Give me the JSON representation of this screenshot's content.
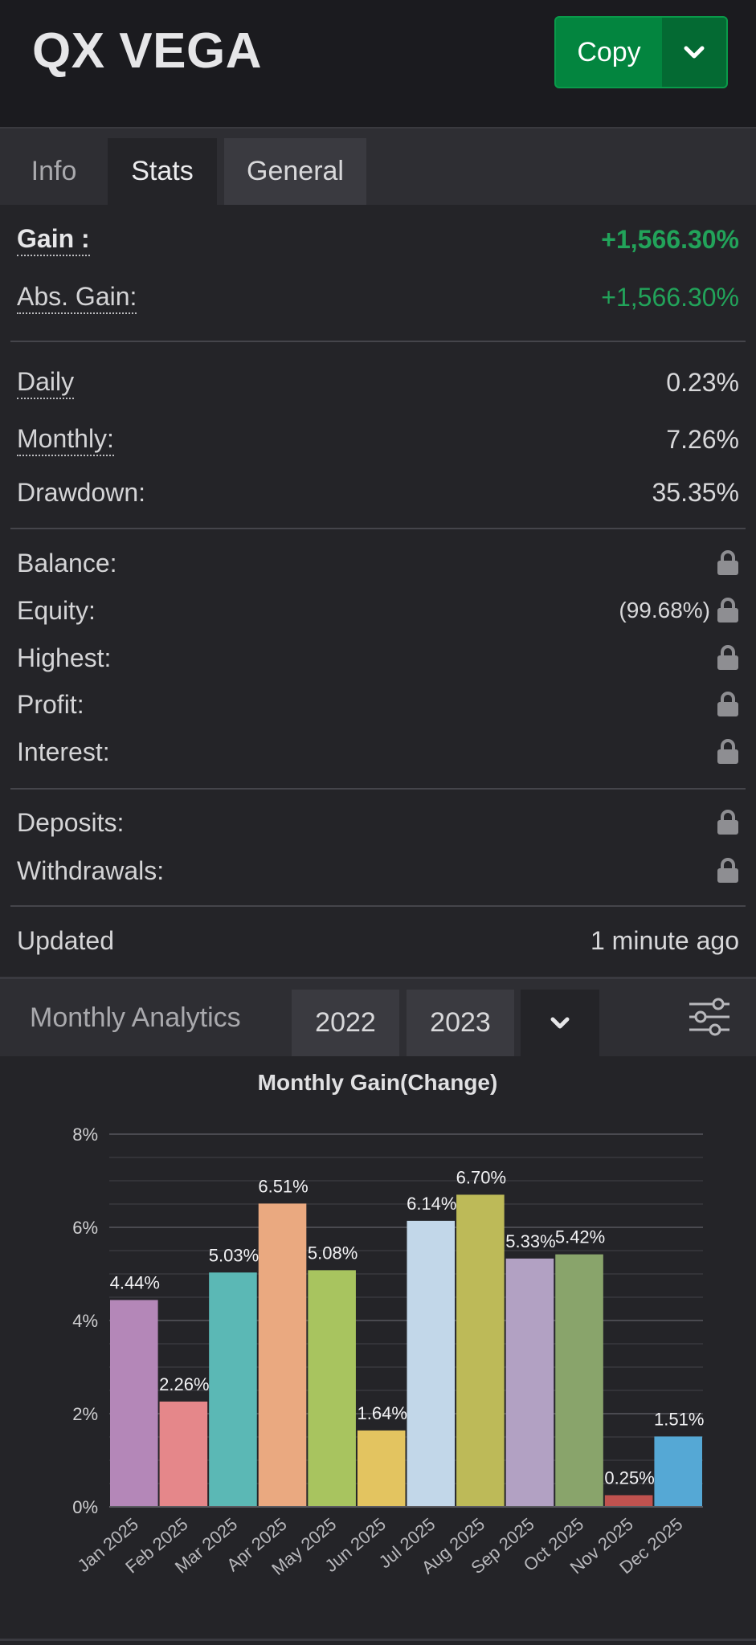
{
  "header": {
    "title": "QX VEGA",
    "copy_label": "Copy"
  },
  "tabs": [
    "Info",
    "Stats",
    "General"
  ],
  "stats": {
    "gain_label": "Gain :",
    "gain_value": "+1,566.30%",
    "abs_gain_label": "Abs. Gain:",
    "abs_gain_value": "+1,566.30%",
    "daily_label": "Daily",
    "daily_value": "0.23%",
    "monthly_label": "Monthly:",
    "monthly_value": "7.26%",
    "drawdown_label": "Drawdown:",
    "drawdown_value": "35.35%",
    "balance_label": "Balance:",
    "equity_label": "Equity:",
    "equity_value": "(99.68%)",
    "highest_label": "Highest:",
    "profit_label": "Profit:",
    "interest_label": "Interest:",
    "deposits_label": "Deposits:",
    "withdrawals_label": "Withdrawals:",
    "updated_label": "Updated",
    "updated_value": "1 minute ago"
  },
  "analytics": {
    "title": "Monthly Analytics",
    "years": [
      "2022",
      "2023"
    ]
  },
  "chart_data": {
    "type": "bar",
    "title": "Monthly Gain(Change)",
    "categories": [
      "Jan 2025",
      "Feb 2025",
      "Mar 2025",
      "Apr 2025",
      "May 2025",
      "Jun 2025",
      "Jul 2025",
      "Aug 2025",
      "Sep 2025",
      "Oct 2025",
      "Nov 2025",
      "Dec 2025"
    ],
    "values": [
      4.44,
      2.26,
      5.03,
      6.51,
      5.08,
      1.64,
      6.14,
      6.7,
      5.33,
      5.42,
      0.25,
      1.51
    ],
    "value_labels": [
      "4.44%",
      "2.26%",
      "5.03%",
      "6.51%",
      "5.08%",
      "1.64%",
      "6.14%",
      "6.70%",
      "5.33%",
      "5.42%",
      "0.25%",
      "1.51%"
    ],
    "colors": [
      "#b487b8",
      "#e5878a",
      "#5bb8b5",
      "#eaa980",
      "#a8c45f",
      "#e3c460",
      "#c2d7e9",
      "#bdba58",
      "#b2a1c3",
      "#89a46b",
      "#c0524f",
      "#55a8d5"
    ],
    "ylim": [
      0,
      8
    ],
    "yticks": [
      "0%",
      "2%",
      "4%",
      "6%",
      "8%"
    ],
    "grid": true
  }
}
